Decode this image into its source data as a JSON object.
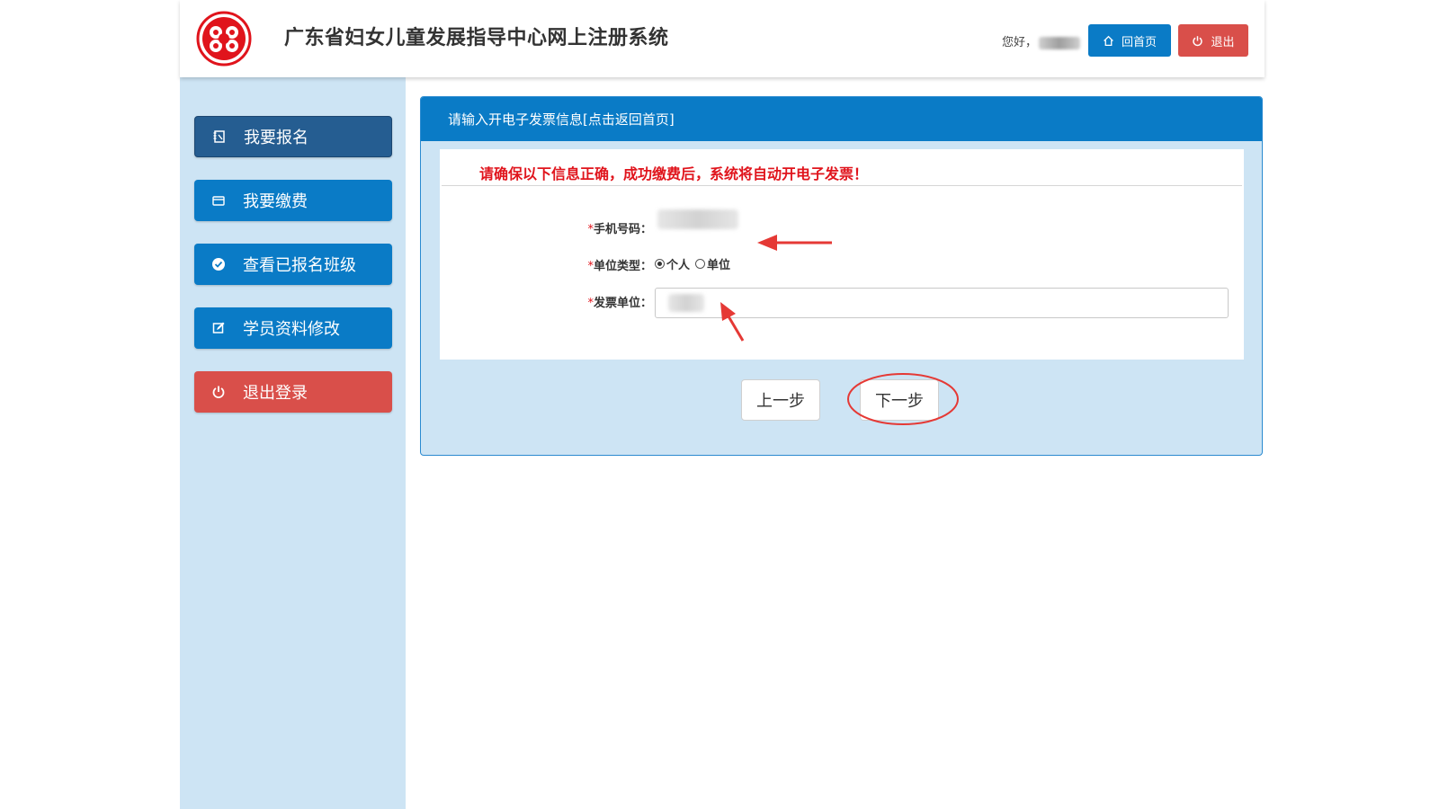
{
  "header": {
    "title": "广东省妇女儿童发展指导中心网上注册系统",
    "greeting": "您好，",
    "home_label": "回首页",
    "logout_label": "退出",
    "logo_icon": "womens-federation-logo",
    "home_icon": "home-icon",
    "logout_icon": "power-icon"
  },
  "sidebar": {
    "items": [
      {
        "label": "我要报名",
        "icon": "register-icon",
        "color": "#255d91",
        "active": true
      },
      {
        "label": "我要缴费",
        "icon": "card-icon",
        "color": "#0a7bc6"
      },
      {
        "label": "查看已报名班级",
        "icon": "check-circle-icon",
        "color": "#0a7bc6"
      },
      {
        "label": "学员资料修改",
        "icon": "edit-icon",
        "color": "#0a7bc6"
      },
      {
        "label": "退出登录",
        "icon": "power-icon",
        "color": "#d94f4a"
      }
    ]
  },
  "panel": {
    "title": "请输入开电子发票信息[点击返回首页]",
    "notice": "请确保以下信息正确，成功缴费后，系统将自动开电子发票！",
    "fields": {
      "phone_label": "手机号码：",
      "unit_type_label": "单位类型：",
      "invoice_unit_label": "发票单位：",
      "required_mark": "*"
    },
    "unit_type_options": [
      {
        "label": "个人",
        "checked": true
      },
      {
        "label": "单位",
        "checked": false
      }
    ]
  },
  "buttons": {
    "prev": "上一步",
    "next": "下一步"
  },
  "colors": {
    "primary": "#0a7bc6",
    "active_nav": "#255d91",
    "danger": "#d94f4a",
    "notice_red": "#e0141c",
    "panel_bg": "#cde4f4",
    "annotation_red": "#e53935"
  }
}
